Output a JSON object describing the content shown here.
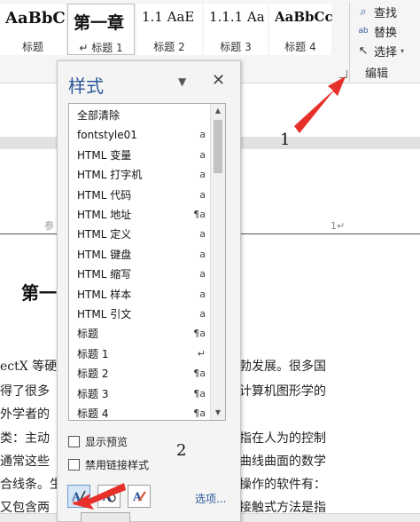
{
  "ribbon": {
    "style_gallery": [
      {
        "preview": "AaBbC",
        "caption": "标题"
      },
      {
        "preview": "第一章",
        "caption": "↵ 标题 1"
      },
      {
        "preview": "1.1  AaE",
        "caption": "标题 2"
      },
      {
        "preview": "1.1.1  Aa",
        "caption": "标题 3"
      },
      {
        "preview": "AaBbCc",
        "caption": "标题 4"
      }
    ],
    "editing": {
      "find_label": "查找",
      "replace_label": "替换",
      "select_label": "选择",
      "group_label": "编辑"
    }
  },
  "document": {
    "header_left": "参",
    "header_right": "1↵",
    "heading": "第一",
    "body_lines": [
      {
        "left": "ectX 等硬",
        "right": "勃发展。很多国"
      },
      {
        "left": "得了很多",
        "right": "计算机图形学的"
      },
      {
        "left": "外学者的",
        "right": ""
      },
      {
        "left": "类：主动",
        "right": "指在人为的控制"
      },
      {
        "left": "通常这些",
        "right": "曲线曲面的数学"
      },
      {
        "left": "合线条。生",
        "right": "操作的软件有："
      },
      {
        "left": "又包含两",
        "right": "接触式方法是指"
      }
    ]
  },
  "annotations": {
    "label_1": "1",
    "label_2": "2",
    "arrow_color": "#e8302a"
  },
  "styles_pane": {
    "title": "样式",
    "menu_icon": "chevron-down-icon",
    "close_icon": "close-icon",
    "items": [
      {
        "label": "全部清除",
        "glyph": ""
      },
      {
        "label": "fontstyle01",
        "glyph": "a"
      },
      {
        "label": "HTML 变量",
        "glyph": "a"
      },
      {
        "label": "HTML 打字机",
        "glyph": "a"
      },
      {
        "label": "HTML 代码",
        "glyph": "a"
      },
      {
        "label": "HTML 地址",
        "glyph": "¶a"
      },
      {
        "label": "HTML 定义",
        "glyph": "a"
      },
      {
        "label": "HTML 键盘",
        "glyph": "a"
      },
      {
        "label": "HTML 缩写",
        "glyph": "a"
      },
      {
        "label": "HTML 样本",
        "glyph": "a"
      },
      {
        "label": "HTML 引文",
        "glyph": "a"
      },
      {
        "label": "标题",
        "glyph": "¶a"
      },
      {
        "label": "标题 1",
        "glyph": "↵"
      },
      {
        "label": "标题 2",
        "glyph": "¶a"
      },
      {
        "label": "标题 3",
        "glyph": "¶a"
      },
      {
        "label": "标题 4",
        "glyph": "¶a"
      }
    ],
    "show_preview_label": "显示预览",
    "disable_linked_label": "禁用链接样式",
    "options_label": "选项...",
    "accent_color": "#2b579a"
  }
}
